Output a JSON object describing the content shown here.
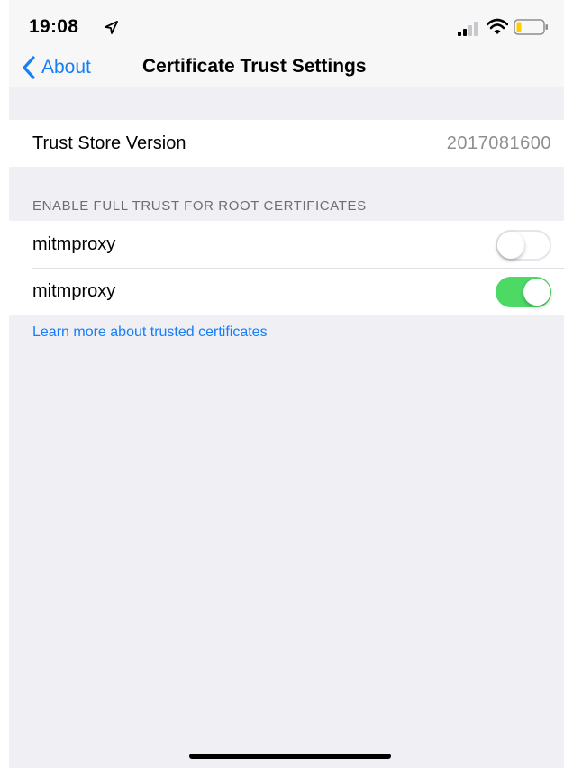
{
  "status_bar": {
    "time": "19:08",
    "icons": [
      "location-arrow-icon",
      "cellular-signal-icon",
      "wifi-icon",
      "battery-icon"
    ]
  },
  "nav": {
    "back_label": "About",
    "title": "Certificate Trust Settings"
  },
  "trust_store": {
    "label": "Trust Store Version",
    "value": "2017081600"
  },
  "section": {
    "header": "ENABLE FULL TRUST FOR ROOT CERTIFICATES",
    "certificates": [
      {
        "name": "mitmproxy",
        "enabled": false
      },
      {
        "name": "mitmproxy",
        "enabled": true
      }
    ]
  },
  "footer_link": "Learn more about trusted certificates",
  "colors": {
    "accent": "#147efb",
    "toggle_on": "#4cd964",
    "background": "#efeff4"
  }
}
